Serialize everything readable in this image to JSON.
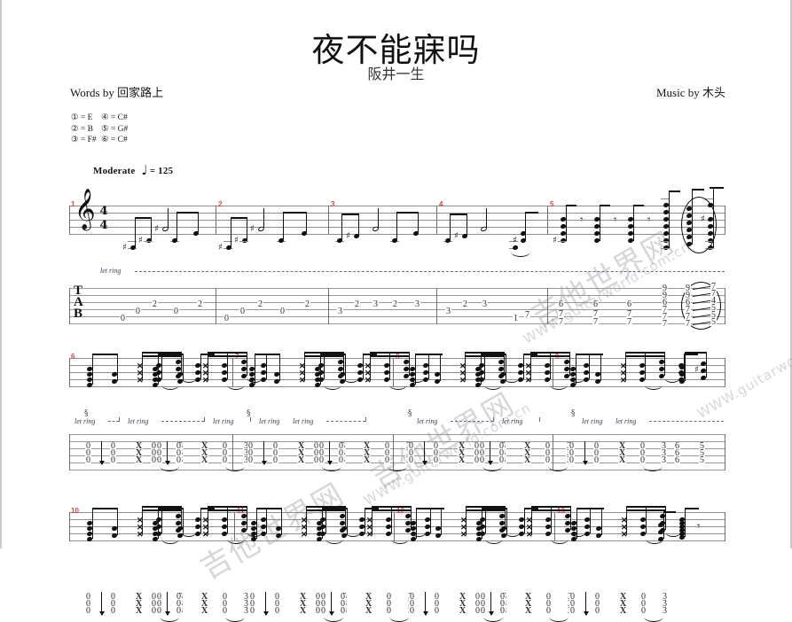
{
  "sheet": {
    "title": "夜不能寐吗",
    "subtitle": "阪井一生",
    "words_by": "Words by 回家路上",
    "music_by": "Music by 木头",
    "tempo_text": "Moderate",
    "tempo_note": "♩",
    "tempo_eq": "= 125",
    "time_signature_top": "4",
    "time_signature_bottom": "4",
    "clef_glyph": "𝄞",
    "tab_clef": [
      "T",
      "A",
      "B"
    ],
    "let_ring_label": "let ring",
    "segno_label": "§",
    "rest_glyph": " ⸞"
  },
  "tuning": {
    "rows": [
      {
        "left_string": "①",
        "left_note": "= E",
        "right_string": "④",
        "right_note": "= C#"
      },
      {
        "left_string": "②",
        "left_note": "= B",
        "right_string": "⑤",
        "right_note": "= G#"
      },
      {
        "left_string": "③",
        "left_note": "= F#",
        "right_string": "⑥",
        "right_note": "= C#"
      }
    ]
  },
  "watermark": {
    "cn": "吉他世界网",
    "url": "WWW.guitarworld.com.cn"
  },
  "colors": {
    "measure_number": "#e2433b",
    "staff_line": "#8d8d8d",
    "note": "#111111",
    "let_ring": "#3b3b5c",
    "watermark": "rgba(120,120,130,0.30)"
  },
  "systems": [
    {
      "name": "system-1",
      "measures": [
        "1",
        "2",
        "3",
        "4",
        "5"
      ],
      "tab_rows": [
        {
          "measure": "1",
          "frets": [
            "0",
            "0",
            "2",
            "0",
            "2"
          ]
        },
        {
          "measure": "2",
          "frets": [
            "0",
            "0",
            "2",
            "0",
            "2"
          ]
        },
        {
          "measure": "3",
          "frets": [
            "3",
            "2",
            "3",
            "2",
            "3"
          ]
        },
        {
          "measure": "4",
          "frets": [
            "3",
            "2",
            "3"
          ]
        },
        {
          "measure": "5",
          "frets": [
            "1",
            "7",
            "6",
            "7",
            "7",
            "6",
            "7",
            "7",
            "6",
            "7",
            "7",
            "9",
            "9",
            "6",
            "7",
            "7",
            "7",
            "9",
            "9",
            "6",
            "7",
            "7",
            "7",
            "7",
            "7",
            "4",
            "5",
            "5",
            "5"
          ]
        }
      ],
      "chord_slide": {
        "from": [
          "9",
          "9",
          "6",
          "7",
          "7",
          "7"
        ],
        "to": [
          "7",
          "7",
          "4",
          "5",
          "5",
          "5"
        ]
      }
    },
    {
      "name": "system-2",
      "measures": [
        "6",
        "7",
        "8",
        "9"
      ],
      "strum_pattern": [
        "0",
        "0",
        "0",
        "X",
        "X",
        "X",
        "0",
        "0",
        "0",
        "3",
        "3",
        "3"
      ],
      "end_frets": [
        "6",
        "6",
        "6",
        "5",
        "5",
        "5"
      ]
    },
    {
      "name": "system-3",
      "measures": [
        "10",
        "11",
        "12",
        "13"
      ],
      "strum_pattern": [
        "0",
        "0",
        "0",
        "X",
        "X",
        "X",
        "0",
        "0",
        "0",
        "3",
        "3",
        "3"
      ]
    }
  ]
}
